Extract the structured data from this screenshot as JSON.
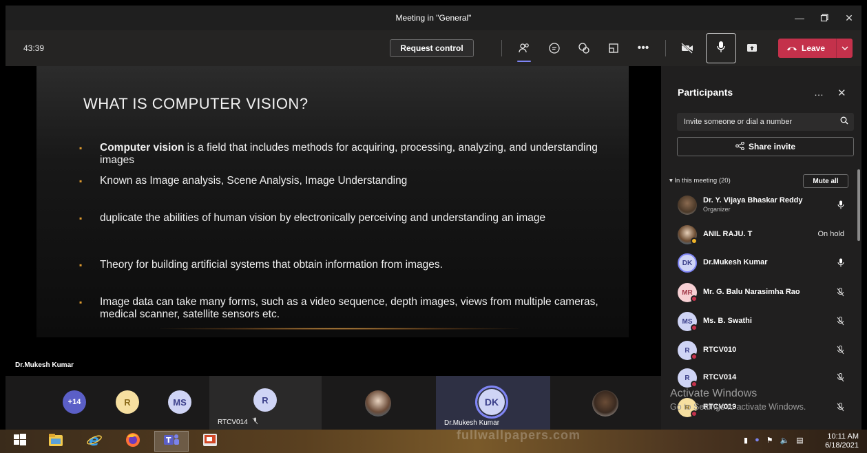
{
  "window": {
    "title": "Meeting in \"General\""
  },
  "toolbar": {
    "timer": "43:39",
    "request_control": "Request control",
    "more": "•••",
    "leave": "Leave"
  },
  "slide": {
    "title": "WHAT IS COMPUTER VISION?",
    "bullets": [
      {
        "bold": "Computer vision",
        "text": " is a field that includes methods for acquiring, processing, analyzing, and understanding images"
      },
      {
        "bold": "",
        "text": "Known as Image analysis, Scene Analysis, Image Understanding"
      },
      {
        "bold": "",
        "text": "duplicate the abilities of human vision by electronically perceiving and understanding an image"
      },
      {
        "bold": "",
        "text": "Theory for building artificial systems that obtain information from images."
      },
      {
        "bold": "",
        "text": "Image data can take many forms, such as a video sequence, depth images, views from multiple cameras, medical scanner, satellite sensors etc."
      }
    ],
    "bullet_mark": "▪",
    "presenter": "Dr.Mukesh Kumar"
  },
  "strip": {
    "overflow_count": "+14",
    "tiles": [
      {
        "initials": "R"
      },
      {
        "initials": "MS"
      },
      {
        "initials": "R",
        "label": "RTCV014"
      },
      {
        "initials": ""
      },
      {
        "initials": "DK",
        "label": "Dr.Mukesh Kumar"
      },
      {
        "initials": ""
      }
    ]
  },
  "panel": {
    "title": "Participants",
    "more": "…",
    "invite_placeholder": "Invite someone or dial a number",
    "share_invite": "Share invite",
    "section": "In this meeting (20)",
    "mute_all": "Mute all",
    "participants": [
      {
        "name": "Dr. Y. Vijaya Bhaskar Reddy",
        "role": "Organizer",
        "initials": "",
        "status": "mic"
      },
      {
        "name": "ANIL RAJU. T",
        "role": "",
        "initials": "",
        "status": "On hold"
      },
      {
        "name": "Dr.Mukesh Kumar",
        "role": "",
        "initials": "DK",
        "status": "mic"
      },
      {
        "name": "Mr. G. Balu Narasimha Rao",
        "role": "",
        "initials": "MR",
        "status": "muted"
      },
      {
        "name": "Ms. B. Swathi",
        "role": "",
        "initials": "MS",
        "status": "muted"
      },
      {
        "name": "RTCV010",
        "role": "",
        "initials": "R",
        "status": "muted"
      },
      {
        "name": "RTCV014",
        "role": "",
        "initials": "R",
        "status": "muted"
      },
      {
        "name": "RTCV019",
        "role": "",
        "initials": "R",
        "status": "muted"
      }
    ]
  },
  "watermark": {
    "line1": "Activate Windows",
    "line2": "Go to Settings to activate Windows.",
    "site": "fullwallpapers.com"
  },
  "taskbar": {
    "time": "10:11 AM",
    "date": "6/18/2021"
  },
  "colors": {
    "leave": "#c4314b",
    "accent": "#7f85f5",
    "panel": "#201f1f",
    "bullet": "#e09b2f"
  }
}
